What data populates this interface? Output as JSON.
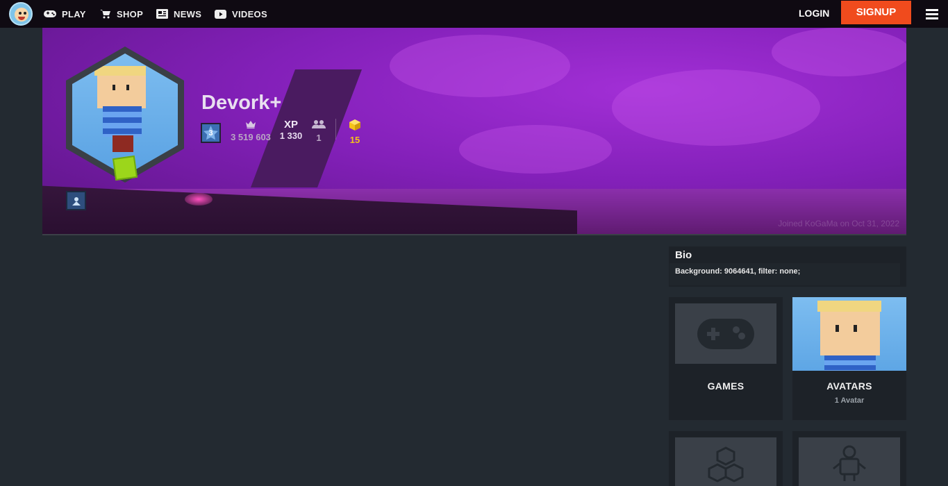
{
  "nav": {
    "play": "PLAY",
    "shop": "SHOP",
    "news": "NEWS",
    "videos": "VIDEOS",
    "login": "LOGIN",
    "signup": "SIGNUP"
  },
  "profile": {
    "username": "Devork+",
    "level": "3",
    "rank_value": "3 519 603",
    "xp_label": "XP",
    "xp_value": "1 330",
    "friends_value": "1",
    "gold_value": "15",
    "joined": "Joined KoGaMa on Oct 31, 2022"
  },
  "bio": {
    "title": "Bio",
    "text": "Background: 9064641, filter: none;"
  },
  "cards": {
    "games": {
      "title": "GAMES"
    },
    "avatars": {
      "title": "AVATARS",
      "sub": "1 Avatar"
    }
  },
  "colors": {
    "signup": "#f04b1d",
    "gold": "#f5c21a",
    "banner": "#8320b9"
  }
}
